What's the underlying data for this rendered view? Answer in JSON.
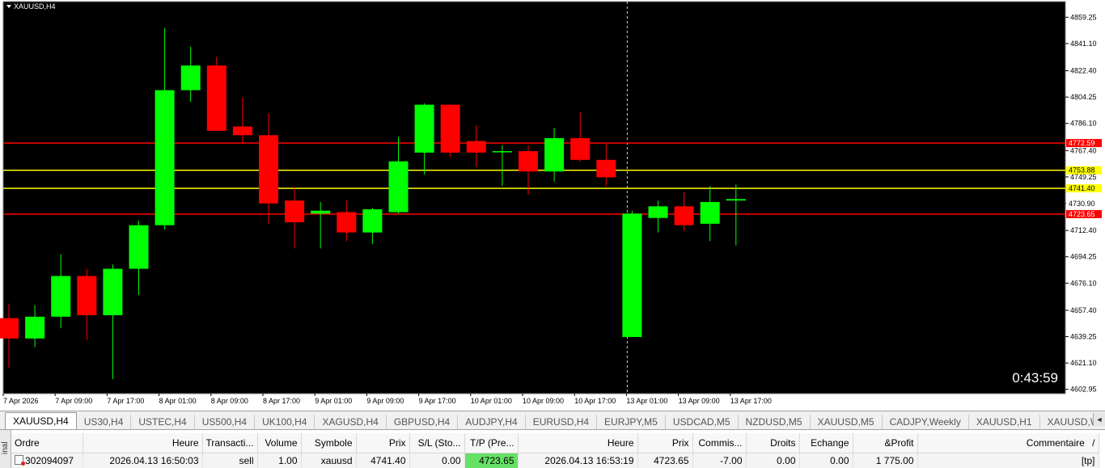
{
  "chart": {
    "symbol_label": "XAUUSD,H4",
    "timer": "0:43:59",
    "colors": {
      "background": "#000000",
      "bull": "#00ff00",
      "bear": "#ff0000",
      "wick_bull": "#00ff00",
      "wick_bear": "#ff0000",
      "axis_text": "#000000",
      "red_line": "#ff0000",
      "yellow_line": "#ffff00"
    },
    "price_range": [
      4600,
      4870
    ]
  },
  "chart_data": {
    "type": "candlestick",
    "price_ticks": [
      "4859.25",
      "4841.10",
      "4822.40",
      "4804.25",
      "4786.10",
      "4767.40",
      "4749.25",
      "4730.90",
      "4712.40",
      "4694.25",
      "4676.10",
      "4657.40",
      "4639.25",
      "4621.10",
      "4602.95"
    ],
    "time_labels": [
      "7 Apr 2026",
      "7 Apr 09:00",
      "7 Apr 17:00",
      "8 Apr 01:00",
      "8 Apr 09:00",
      "8 Apr 17:00",
      "9 Apr 01:00",
      "9 Apr 09:00",
      "9 Apr 17:00",
      "10 Apr 01:00",
      "10 Apr 09:00",
      "10 Apr 17:00",
      "13 Apr 01:00",
      "13 Apr 09:00",
      "13 Apr 17:00"
    ],
    "candles": [
      {
        "o": 4652,
        "h": 4662,
        "l": 4618,
        "c": 4638
      },
      {
        "o": 4638,
        "h": 4661,
        "l": 4632,
        "c": 4653
      },
      {
        "o": 4653,
        "h": 4696,
        "l": 4645,
        "c": 4681
      },
      {
        "o": 4681,
        "h": 4686,
        "l": 4637,
        "c": 4654
      },
      {
        "o": 4654,
        "h": 4689,
        "l": 4610,
        "c": 4686
      },
      {
        "o": 4686,
        "h": 4719,
        "l": 4668,
        "c": 4716
      },
      {
        "o": 4716,
        "h": 4852,
        "l": 4713,
        "c": 4809
      },
      {
        "o": 4809,
        "h": 4839,
        "l": 4801,
        "c": 4826
      },
      {
        "o": 4826,
        "h": 4832,
        "l": 4782,
        "c": 4781
      },
      {
        "o": 4784,
        "h": 4804,
        "l": 4772,
        "c": 4778
      },
      {
        "o": 4778,
        "h": 4793,
        "l": 4717,
        "c": 4731
      },
      {
        "o": 4733,
        "h": 4742,
        "l": 4700,
        "c": 4718
      },
      {
        "o": 4724,
        "h": 4732,
        "l": 4700,
        "c": 4726
      },
      {
        "o": 4725,
        "h": 4733,
        "l": 4705,
        "c": 4711
      },
      {
        "o": 4711,
        "h": 4728,
        "l": 4703,
        "c": 4727
      },
      {
        "o": 4725,
        "h": 4777,
        "l": 4724,
        "c": 4760
      },
      {
        "o": 4766,
        "h": 4800,
        "l": 4751,
        "c": 4799
      },
      {
        "o": 4799,
        "h": 4799,
        "l": 4763,
        "c": 4766
      },
      {
        "o": 4774,
        "h": 4785,
        "l": 4756,
        "c": 4766
      },
      {
        "o": 4767,
        "h": 4771,
        "l": 4743,
        "c": 4767
      },
      {
        "o": 4767,
        "h": 4771,
        "l": 4737,
        "c": 4753
      },
      {
        "o": 4753,
        "h": 4783,
        "l": 4746,
        "c": 4776
      },
      {
        "o": 4776,
        "h": 4794,
        "l": 4760,
        "c": 4761
      },
      {
        "o": 4761,
        "h": 4772,
        "l": 4743,
        "c": 4749
      },
      {
        "o": 4639,
        "h": 4726,
        "l": 4639,
        "c": 4724
      },
      {
        "o": 4721,
        "h": 4733,
        "l": 4711,
        "c": 4729
      },
      {
        "o": 4729,
        "h": 4739,
        "l": 4712,
        "c": 4716
      },
      {
        "o": 4717,
        "h": 4743,
        "l": 4705,
        "c": 4732
      },
      {
        "o": 4733,
        "h": 4744,
        "l": 4702,
        "c": 4734
      }
    ],
    "hlines": [
      {
        "price": 4772.59,
        "label": "4772.59",
        "color": "#ff0000"
      },
      {
        "price": 4753.88,
        "label": "4753.88",
        "color": "#ffff00"
      },
      {
        "price": 4741.4,
        "label": "4741.40",
        "color": "#ffff00"
      },
      {
        "price": 4730.9,
        "label": "4730.90",
        "color": "#ffffff"
      },
      {
        "price": 4723.65,
        "label": "4723.65",
        "color": "#ff0000"
      }
    ],
    "vline_at_label": "13 Apr 01:00"
  },
  "tabs": [
    "XAUUSD,H4",
    "US30,H4",
    "USTEC,H4",
    "US500,H4",
    "UK100,H4",
    "XAGUSD,H4",
    "GBPUSD,H4",
    "AUDJPY,H4",
    "EURUSD,H4",
    "EURJPY,M5",
    "USDCAD,M5",
    "NZDUSD,M5",
    "XAUUSD,M5",
    "CADJPY,Weekly",
    "XAUUSD,H1",
    "XAUUSD,Wee"
  ],
  "terminal": {
    "side_label": "inal",
    "columns": [
      "Ordre",
      "Heure",
      "Transacti...",
      "Volume",
      "Symbole",
      "Prix",
      "S/L (Sto...",
      "T/P (Pre...",
      "Heure",
      "Prix",
      "Commis...",
      "Droits",
      "Echange",
      "&Profit",
      "Commentaire"
    ],
    "sort_indicator": "/",
    "row": [
      "302094097",
      "2026.04.13 16:50:03",
      "sell",
      "1.00",
      "xauusd",
      "4741.40",
      "0.00",
      "4723.65",
      "2026.04.13 16:53:19",
      "4723.65",
      "-7.00",
      "0.00",
      "0.00",
      "1 775.00",
      "[tp]"
    ]
  }
}
